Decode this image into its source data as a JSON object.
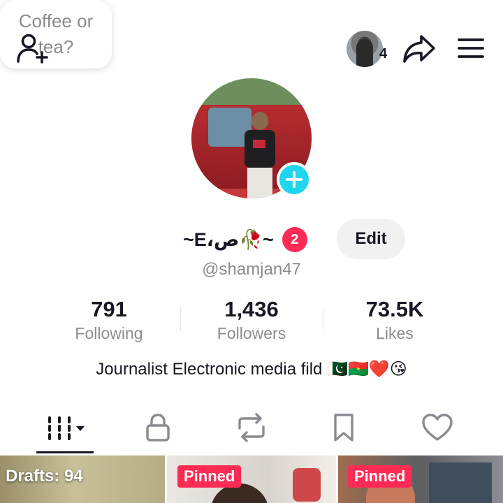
{
  "header": {
    "visitor_count": "4",
    "bubble_text": "Coffee or tea?"
  },
  "profile": {
    "display_name": "~E،ص🥀~",
    "notification_count": "2",
    "edit_label": "Edit",
    "username": "@shamjan47",
    "bio": "Journalist Electronic media fild 🇵🇰🇧🇫❤️😘"
  },
  "stats": [
    {
      "value": "791",
      "label": "Following"
    },
    {
      "value": "1,436",
      "label": "Followers"
    },
    {
      "value": "73.5K",
      "label": "Likes"
    }
  ],
  "tabs": [
    {
      "icon": "videos-grid-icon",
      "active": true
    },
    {
      "icon": "lock-icon",
      "active": false
    },
    {
      "icon": "repost-icon",
      "active": false
    },
    {
      "icon": "bookmark-icon",
      "active": false
    },
    {
      "icon": "heart-icon",
      "active": false
    }
  ],
  "grid": {
    "drafts_label": "Drafts: 94",
    "pinned_label_1": "Pinned",
    "pinned_label_2": "Pinned"
  },
  "colors": {
    "accent_pink": "#fe2c55",
    "accent_cyan": "#20d5ec",
    "text_primary": "#161823",
    "text_secondary": "#8a8b91"
  }
}
